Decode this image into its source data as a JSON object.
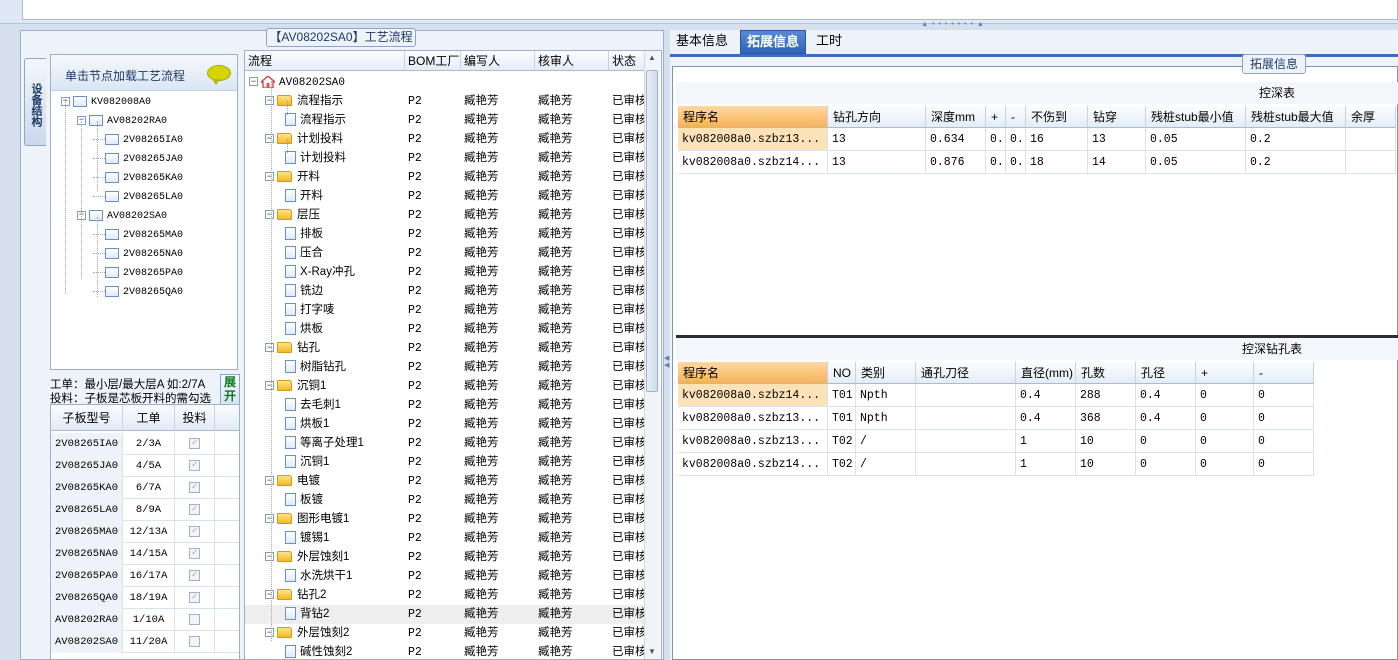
{
  "left_panel": {
    "title": "【AV08202SA0】工艺流程",
    "vertical_tab": "设备结构",
    "tree_header": "单击节点加载工艺流程",
    "tree": [
      {
        "label": "KV082008A0",
        "level": 0,
        "expander": "−"
      },
      {
        "label": "AV08202RA0",
        "level": 1,
        "expander": "−"
      },
      {
        "label": "2V08265IA0",
        "level": 2
      },
      {
        "label": "2V08265JA0",
        "level": 2
      },
      {
        "label": "2V08265KA0",
        "level": 2
      },
      {
        "label": "2V08265LA0",
        "level": 2
      },
      {
        "label": "AV08202SA0",
        "level": 1,
        "expander": "−"
      },
      {
        "label": "2V08265MA0",
        "level": 2
      },
      {
        "label": "2V08265NA0",
        "level": 2
      },
      {
        "label": "2V08265PA0",
        "level": 2
      },
      {
        "label": "2V08265QA0",
        "level": 2
      }
    ],
    "info_line1": "工单：最小层/最大层A 如:2/7A",
    "info_line2": "投料：子板是芯板开料的需勾选",
    "expand_button": "展开",
    "sub_grid": {
      "headers": [
        "子板型号",
        "工单",
        "投料"
      ],
      "rows": [
        {
          "model": "2V08265IA0",
          "order": "2/3A",
          "checked": true
        },
        {
          "model": "2V08265JA0",
          "order": "4/5A",
          "checked": true
        },
        {
          "model": "2V08265KA0",
          "order": "6/7A",
          "checked": true
        },
        {
          "model": "2V08265LA0",
          "order": "8/9A",
          "checked": true
        },
        {
          "model": "2V08265MA0",
          "order": "12/13A",
          "checked": true
        },
        {
          "model": "2V08265NA0",
          "order": "14/15A",
          "checked": true
        },
        {
          "model": "2V08265PA0",
          "order": "16/17A",
          "checked": true
        },
        {
          "model": "2V08265QA0",
          "order": "18/19A",
          "checked": true
        },
        {
          "model": "AV08202RA0",
          "order": "1/10A",
          "checked": false
        },
        {
          "model": "AV08202SA0",
          "order": "11/20A",
          "checked": false
        }
      ]
    }
  },
  "flow_grid": {
    "headers": [
      "流程",
      "BOM工厂",
      "编写人",
      "核审人",
      "状态"
    ],
    "root": "AV08202SA0",
    "rows": [
      {
        "name": "流程指示",
        "folder": true,
        "factory": "P2",
        "writer": "臧艳芳",
        "reviewer": "臧艳芳",
        "status": "已审核"
      },
      {
        "name": "流程指示",
        "folder": false,
        "factory": "P2",
        "writer": "臧艳芳",
        "reviewer": "臧艳芳",
        "status": "已审核"
      },
      {
        "name": "计划投料",
        "folder": true,
        "factory": "P2",
        "writer": "臧艳芳",
        "reviewer": "臧艳芳",
        "status": "已审核"
      },
      {
        "name": "计划投料",
        "folder": false,
        "factory": "P2",
        "writer": "臧艳芳",
        "reviewer": "臧艳芳",
        "status": "已审核"
      },
      {
        "name": "开料",
        "folder": true,
        "factory": "P2",
        "writer": "臧艳芳",
        "reviewer": "臧艳芳",
        "status": "已审核"
      },
      {
        "name": "开料",
        "folder": false,
        "factory": "P2",
        "writer": "臧艳芳",
        "reviewer": "臧艳芳",
        "status": "已审核"
      },
      {
        "name": "层压",
        "folder": true,
        "factory": "P2",
        "writer": "臧艳芳",
        "reviewer": "臧艳芳",
        "status": "已审核"
      },
      {
        "name": "排板",
        "folder": false,
        "factory": "P2",
        "writer": "臧艳芳",
        "reviewer": "臧艳芳",
        "status": "已审核"
      },
      {
        "name": "压合",
        "folder": false,
        "factory": "P2",
        "writer": "臧艳芳",
        "reviewer": "臧艳芳",
        "status": "已审核"
      },
      {
        "name": "X-Ray冲孔",
        "folder": false,
        "factory": "P2",
        "writer": "臧艳芳",
        "reviewer": "臧艳芳",
        "status": "已审核"
      },
      {
        "name": "铣边",
        "folder": false,
        "factory": "P2",
        "writer": "臧艳芳",
        "reviewer": "臧艳芳",
        "status": "已审核"
      },
      {
        "name": "打字唛",
        "folder": false,
        "factory": "P2",
        "writer": "臧艳芳",
        "reviewer": "臧艳芳",
        "status": "已审核"
      },
      {
        "name": "烘板",
        "folder": false,
        "factory": "P2",
        "writer": "臧艳芳",
        "reviewer": "臧艳芳",
        "status": "已审核"
      },
      {
        "name": "钻孔",
        "folder": true,
        "factory": "P2",
        "writer": "臧艳芳",
        "reviewer": "臧艳芳",
        "status": "已审核"
      },
      {
        "name": "树脂钻孔",
        "folder": false,
        "factory": "P2",
        "writer": "臧艳芳",
        "reviewer": "臧艳芳",
        "status": "已审核"
      },
      {
        "name": "沉铜1",
        "folder": true,
        "factory": "P2",
        "writer": "臧艳芳",
        "reviewer": "臧艳芳",
        "status": "已审核"
      },
      {
        "name": "去毛刺1",
        "folder": false,
        "factory": "P2",
        "writer": "臧艳芳",
        "reviewer": "臧艳芳",
        "status": "已审核"
      },
      {
        "name": "烘板1",
        "folder": false,
        "factory": "P2",
        "writer": "臧艳芳",
        "reviewer": "臧艳芳",
        "status": "已审核"
      },
      {
        "name": "等离子处理1",
        "folder": false,
        "factory": "P2",
        "writer": "臧艳芳",
        "reviewer": "臧艳芳",
        "status": "已审核"
      },
      {
        "name": "沉铜1",
        "folder": false,
        "factory": "P2",
        "writer": "臧艳芳",
        "reviewer": "臧艳芳",
        "status": "已审核"
      },
      {
        "name": "电镀",
        "folder": true,
        "factory": "P2",
        "writer": "臧艳芳",
        "reviewer": "臧艳芳",
        "status": "已审核"
      },
      {
        "name": "板镀",
        "folder": false,
        "factory": "P2",
        "writer": "臧艳芳",
        "reviewer": "臧艳芳",
        "status": "已审核"
      },
      {
        "name": "图形电镀1",
        "folder": true,
        "factory": "P2",
        "writer": "臧艳芳",
        "reviewer": "臧艳芳",
        "status": "已审核"
      },
      {
        "name": "镀锡1",
        "folder": false,
        "factory": "P2",
        "writer": "臧艳芳",
        "reviewer": "臧艳芳",
        "status": "已审核"
      },
      {
        "name": "外层蚀刻1",
        "folder": true,
        "factory": "P2",
        "writer": "臧艳芳",
        "reviewer": "臧艳芳",
        "status": "已审核"
      },
      {
        "name": "水洗烘干1",
        "folder": false,
        "factory": "P2",
        "writer": "臧艳芳",
        "reviewer": "臧艳芳",
        "status": "已审核"
      },
      {
        "name": "钻孔2",
        "folder": true,
        "factory": "P2",
        "writer": "臧艳芳",
        "reviewer": "臧艳芳",
        "status": "已审核"
      },
      {
        "name": "背钻2",
        "folder": false,
        "factory": "P2",
        "writer": "臧艳芳",
        "reviewer": "臧艳芳",
        "status": "已审核",
        "selected": true
      },
      {
        "name": "外层蚀刻2",
        "folder": true,
        "factory": "P2",
        "writer": "臧艳芳",
        "reviewer": "臧艳芳",
        "status": "已审核"
      },
      {
        "name": "碱性蚀刻2",
        "folder": false,
        "factory": "P2",
        "writer": "臧艳芳",
        "reviewer": "臧艳芳",
        "status": "已审核"
      }
    ]
  },
  "right_panel": {
    "tabs": [
      "基本信息",
      "拓展信息",
      "工时"
    ],
    "active_tab": "拓展信息",
    "group_label": "拓展信息",
    "depth_table": {
      "title": "控深表",
      "headers": [
        "程序名",
        "钻孔方向",
        "深度mm",
        "+",
        "-",
        "不伤到",
        "钻穿",
        "残桩stub最小值",
        "残桩stub最大值",
        "余厚"
      ],
      "rows": [
        [
          "kv082008a0.szbz13...",
          "13",
          "0.634",
          "0..",
          "0..",
          "16",
          "13",
          "0.05",
          "0.2",
          ""
        ],
        [
          "kv082008a0.szbz14...",
          "13",
          "0.876",
          "0..",
          "0..",
          "18",
          "14",
          "0.05",
          "0.2",
          ""
        ]
      ]
    },
    "hole_table": {
      "title": "控深钻孔表",
      "headers": [
        "程序名",
        "NO",
        "类别",
        "通孔刀径",
        "直径(mm)",
        "孔数",
        "孔径",
        "+",
        "-"
      ],
      "rows": [
        [
          "kv082008a0.szbz14...",
          "T01",
          "Npth",
          "",
          "0.4",
          "288",
          "0.4",
          "0",
          "0"
        ],
        [
          "kv082008a0.szbz13...",
          "T01",
          "Npth",
          "",
          "0.4",
          "368",
          "0.4",
          "0",
          "0"
        ],
        [
          "kv082008a0.szbz13...",
          "T02",
          "/",
          "",
          "1",
          "10",
          "0",
          "0",
          "0"
        ],
        [
          "kv082008a0.szbz14...",
          "T02",
          "/",
          "",
          "1",
          "10",
          "0",
          "0",
          "0"
        ]
      ]
    }
  },
  "colors": {
    "accent": "#2e63b8",
    "selected_header": "#f7b25a",
    "selected_cell": "#fde2b8",
    "panel_bg": "#eef3fa"
  }
}
